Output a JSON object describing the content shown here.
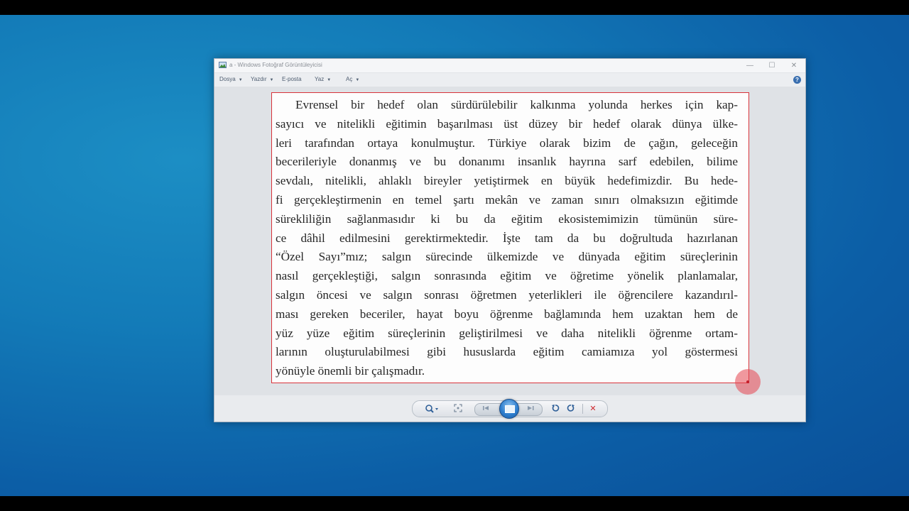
{
  "window": {
    "title": "a - Windows Fotoğraf Görüntüleyicisi",
    "controls": {
      "minimize": "—",
      "maximize": "☐",
      "close": "✕"
    }
  },
  "menu": {
    "items": [
      {
        "label": "Dosya"
      },
      {
        "label": "Yazdır"
      },
      {
        "label": "E-posta"
      },
      {
        "label": "Yaz"
      },
      {
        "label": "Aç"
      }
    ],
    "help": "?"
  },
  "photo": {
    "lines": [
      "Evrensel bir hedef olan sürdürülebilir kalkınma yolunda herkes için kap-",
      "sayıcı ve nitelikli eğitimin başarılması üst düzey bir hedef olarak dünya ülke-",
      "leri tarafından ortaya konulmuştur. Türkiye olarak bizim de çağın, geleceğin",
      "becerileriyle donanmış ve bu donanımı insanlık hayrına sarf edebilen, bilime",
      "sevdalı, nitelikli, ahlaklı bireyler yetiştirmek en büyük hedefimizdir. Bu hede-",
      "fi gerçekleştirmenin en temel şartı mekân ve zaman sınırı olmaksızın eğitimde",
      "sürekliliğin sağlanmasıdır ki bu da eğitim ekosistemimizin tümünün süre-",
      "ce dâhil edilmesini gerektirmektedir. İşte tam da bu doğrultuda hazırlanan",
      "“Özel Sayı”mız; salgın sürecinde ülkemizde ve dünyada eğitim süreçlerinin",
      "nasıl gerçekleştiği, salgın sonrasında eğitim ve öğretime yönelik planlamalar,",
      "salgın öncesi ve salgın sonrası öğretmen yeterlikleri ile öğrencilere kazandırıl-",
      "ması gereken beceriler, hayat boyu öğrenme bağlamında hem uzaktan hem de",
      "yüz yüze eğitim süreçlerinin geliştirilmesi ve daha nitelikli öğrenme ortam-",
      "larının oluşturulabilmesi gibi hususlarda eğitim camiamıza yol göstermesi",
      "yönüyle önemli bir çalışmadır."
    ]
  },
  "toolbar": {
    "zoom_icon": "magnifier-icon",
    "fit_icon": "actual-size-icon",
    "prev_icon": "previous-icon",
    "slideshow_icon": "slideshow-icon",
    "next_icon": "next-icon",
    "rotate_ccw_icon": "rotate-left-icon",
    "rotate_cw_icon": "rotate-right-icon",
    "delete_icon": "delete-icon"
  }
}
